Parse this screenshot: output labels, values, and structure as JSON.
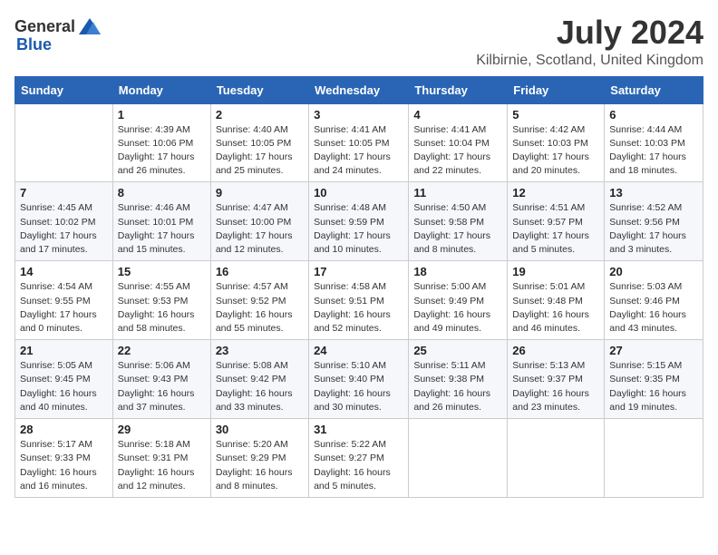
{
  "header": {
    "logo_general": "General",
    "logo_blue": "Blue",
    "month_title": "July 2024",
    "location": "Kilbirnie, Scotland, United Kingdom"
  },
  "days_of_week": [
    "Sunday",
    "Monday",
    "Tuesday",
    "Wednesday",
    "Thursday",
    "Friday",
    "Saturday"
  ],
  "weeks": [
    [
      {
        "day": "",
        "info": ""
      },
      {
        "day": "1",
        "info": "Sunrise: 4:39 AM\nSunset: 10:06 PM\nDaylight: 17 hours\nand 26 minutes."
      },
      {
        "day": "2",
        "info": "Sunrise: 4:40 AM\nSunset: 10:05 PM\nDaylight: 17 hours\nand 25 minutes."
      },
      {
        "day": "3",
        "info": "Sunrise: 4:41 AM\nSunset: 10:05 PM\nDaylight: 17 hours\nand 24 minutes."
      },
      {
        "day": "4",
        "info": "Sunrise: 4:41 AM\nSunset: 10:04 PM\nDaylight: 17 hours\nand 22 minutes."
      },
      {
        "day": "5",
        "info": "Sunrise: 4:42 AM\nSunset: 10:03 PM\nDaylight: 17 hours\nand 20 minutes."
      },
      {
        "day": "6",
        "info": "Sunrise: 4:44 AM\nSunset: 10:03 PM\nDaylight: 17 hours\nand 18 minutes."
      }
    ],
    [
      {
        "day": "7",
        "info": "Sunrise: 4:45 AM\nSunset: 10:02 PM\nDaylight: 17 hours\nand 17 minutes."
      },
      {
        "day": "8",
        "info": "Sunrise: 4:46 AM\nSunset: 10:01 PM\nDaylight: 17 hours\nand 15 minutes."
      },
      {
        "day": "9",
        "info": "Sunrise: 4:47 AM\nSunset: 10:00 PM\nDaylight: 17 hours\nand 12 minutes."
      },
      {
        "day": "10",
        "info": "Sunrise: 4:48 AM\nSunset: 9:59 PM\nDaylight: 17 hours\nand 10 minutes."
      },
      {
        "day": "11",
        "info": "Sunrise: 4:50 AM\nSunset: 9:58 PM\nDaylight: 17 hours\nand 8 minutes."
      },
      {
        "day": "12",
        "info": "Sunrise: 4:51 AM\nSunset: 9:57 PM\nDaylight: 17 hours\nand 5 minutes."
      },
      {
        "day": "13",
        "info": "Sunrise: 4:52 AM\nSunset: 9:56 PM\nDaylight: 17 hours\nand 3 minutes."
      }
    ],
    [
      {
        "day": "14",
        "info": "Sunrise: 4:54 AM\nSunset: 9:55 PM\nDaylight: 17 hours\nand 0 minutes."
      },
      {
        "day": "15",
        "info": "Sunrise: 4:55 AM\nSunset: 9:53 PM\nDaylight: 16 hours\nand 58 minutes."
      },
      {
        "day": "16",
        "info": "Sunrise: 4:57 AM\nSunset: 9:52 PM\nDaylight: 16 hours\nand 55 minutes."
      },
      {
        "day": "17",
        "info": "Sunrise: 4:58 AM\nSunset: 9:51 PM\nDaylight: 16 hours\nand 52 minutes."
      },
      {
        "day": "18",
        "info": "Sunrise: 5:00 AM\nSunset: 9:49 PM\nDaylight: 16 hours\nand 49 minutes."
      },
      {
        "day": "19",
        "info": "Sunrise: 5:01 AM\nSunset: 9:48 PM\nDaylight: 16 hours\nand 46 minutes."
      },
      {
        "day": "20",
        "info": "Sunrise: 5:03 AM\nSunset: 9:46 PM\nDaylight: 16 hours\nand 43 minutes."
      }
    ],
    [
      {
        "day": "21",
        "info": "Sunrise: 5:05 AM\nSunset: 9:45 PM\nDaylight: 16 hours\nand 40 minutes."
      },
      {
        "day": "22",
        "info": "Sunrise: 5:06 AM\nSunset: 9:43 PM\nDaylight: 16 hours\nand 37 minutes."
      },
      {
        "day": "23",
        "info": "Sunrise: 5:08 AM\nSunset: 9:42 PM\nDaylight: 16 hours\nand 33 minutes."
      },
      {
        "day": "24",
        "info": "Sunrise: 5:10 AM\nSunset: 9:40 PM\nDaylight: 16 hours\nand 30 minutes."
      },
      {
        "day": "25",
        "info": "Sunrise: 5:11 AM\nSunset: 9:38 PM\nDaylight: 16 hours\nand 26 minutes."
      },
      {
        "day": "26",
        "info": "Sunrise: 5:13 AM\nSunset: 9:37 PM\nDaylight: 16 hours\nand 23 minutes."
      },
      {
        "day": "27",
        "info": "Sunrise: 5:15 AM\nSunset: 9:35 PM\nDaylight: 16 hours\nand 19 minutes."
      }
    ],
    [
      {
        "day": "28",
        "info": "Sunrise: 5:17 AM\nSunset: 9:33 PM\nDaylight: 16 hours\nand 16 minutes."
      },
      {
        "day": "29",
        "info": "Sunrise: 5:18 AM\nSunset: 9:31 PM\nDaylight: 16 hours\nand 12 minutes."
      },
      {
        "day": "30",
        "info": "Sunrise: 5:20 AM\nSunset: 9:29 PM\nDaylight: 16 hours\nand 8 minutes."
      },
      {
        "day": "31",
        "info": "Sunrise: 5:22 AM\nSunset: 9:27 PM\nDaylight: 16 hours\nand 5 minutes."
      },
      {
        "day": "",
        "info": ""
      },
      {
        "day": "",
        "info": ""
      },
      {
        "day": "",
        "info": ""
      }
    ]
  ]
}
